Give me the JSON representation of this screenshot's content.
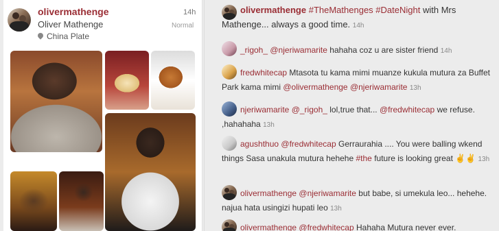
{
  "post": {
    "username": "olivermathenge",
    "full_name": "Oliver Mathenge",
    "location": "China Plate",
    "time": "14h",
    "filter": "Normal",
    "caption": {
      "user": "olivermathenge",
      "tag1": "#TheMathenges",
      "tag2": "#DateNight",
      "text": "with Mrs Mathenge... always a good time.",
      "time": "14h"
    }
  },
  "comments": [
    {
      "user": "_rigoh_",
      "mention1": "@njeriwamarite",
      "text": "hahaha coz u are sister friend",
      "time": "14h"
    },
    {
      "user": "fredwhitecap",
      "text": "Mtasota tu kama mimi muanze kukula mutura za Buffet Park kama mimi",
      "mention1": "@olivermathenge",
      "mention2": "@njeriwamarite",
      "time": "13h"
    },
    {
      "user": "njeriwamarite",
      "mention1": "@_rigoh_",
      "text_mid": "lol,true that...",
      "mention2": "@fredwhitecap",
      "text_end": "we refuse. ,hahahaha",
      "time": "13h"
    },
    {
      "user": "agushthuo",
      "mention1": "@fredwhitecap",
      "text": "Gerraurahia .... You were balling wkend things Sasa unakula mutura hehehe",
      "tag": "#the",
      "text_end": "future is looking great",
      "emoji": "✌️✌️",
      "time": "13h"
    },
    {
      "user": "olivermathenge",
      "mention1": "@njeriwamarite",
      "text": "but babe, si umekula leo... hehehe. najua hata usingizi hupati leo",
      "time": "13h"
    },
    {
      "user": "olivermathenge",
      "mention1": "@fredwhitecap",
      "text": "Hahaha Mutura never ever."
    }
  ]
}
